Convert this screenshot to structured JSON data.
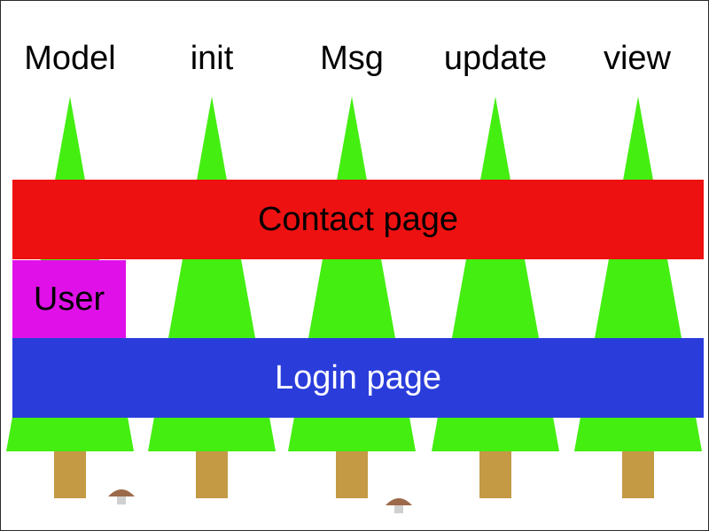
{
  "columns": [
    "Model",
    "init",
    "Msg",
    "update",
    "view"
  ],
  "bands": {
    "contact": "Contact page",
    "user": "User",
    "login": "Login page"
  },
  "colors": {
    "tree": "#44ee11",
    "trunk": "#c49a45",
    "contact": "#ee1111",
    "user": "#e011e8",
    "login": "#2a3ddb",
    "mushroom_cap": "#9c6a4a",
    "mushroom_stem": "#d0d0d0"
  },
  "icons": [
    "tree-icon",
    "mushroom-icon"
  ]
}
